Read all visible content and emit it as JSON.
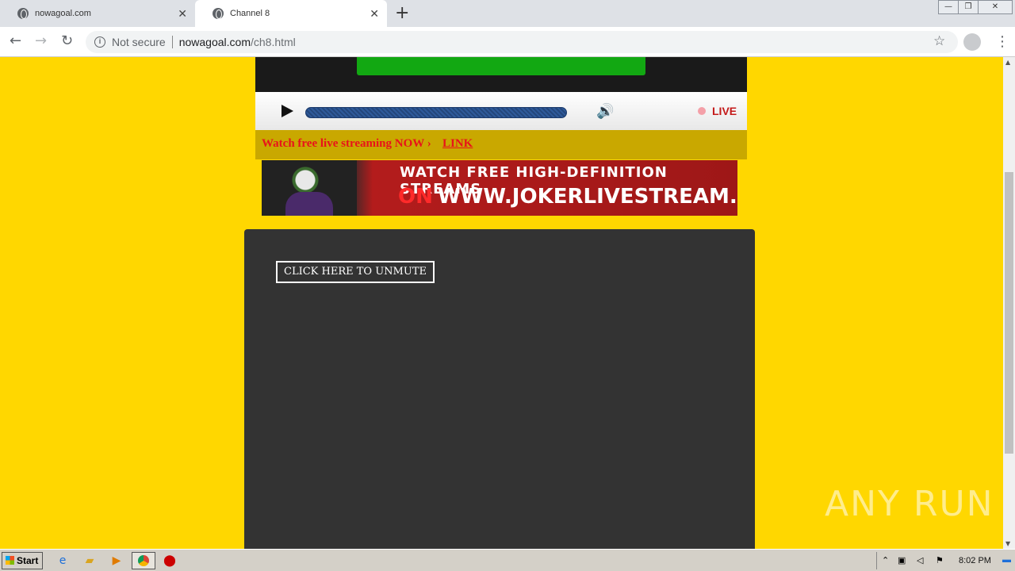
{
  "browser": {
    "tabs": [
      {
        "title": "nowagoal.com",
        "active": false
      },
      {
        "title": "Channel 8",
        "active": true
      }
    ],
    "new_tab_icon": "+",
    "address": {
      "security_label": "Not secure",
      "host": "nowagoal.com",
      "path": "/ch8.html"
    }
  },
  "page": {
    "player_bar": {
      "live_label": "LIVE"
    },
    "link_bar": {
      "text": "Watch free live streaming NOW ›",
      "link_label": "LINK"
    },
    "banner": {
      "line1": "WATCH FREE HIGH-DEFINITION STREAMS",
      "on": "ON",
      "url": "WWW.JOKERLIVESTREAM.COM"
    },
    "unmute_button": "CLICK HERE TO UNMUTE"
  },
  "watermark": "ANY RUN",
  "taskbar": {
    "start_label": "Start",
    "clock": "8:02 PM"
  },
  "colors": {
    "page_bg": "#ffd700",
    "live_red": "#c41a1a",
    "link_red": "#e8131a"
  }
}
